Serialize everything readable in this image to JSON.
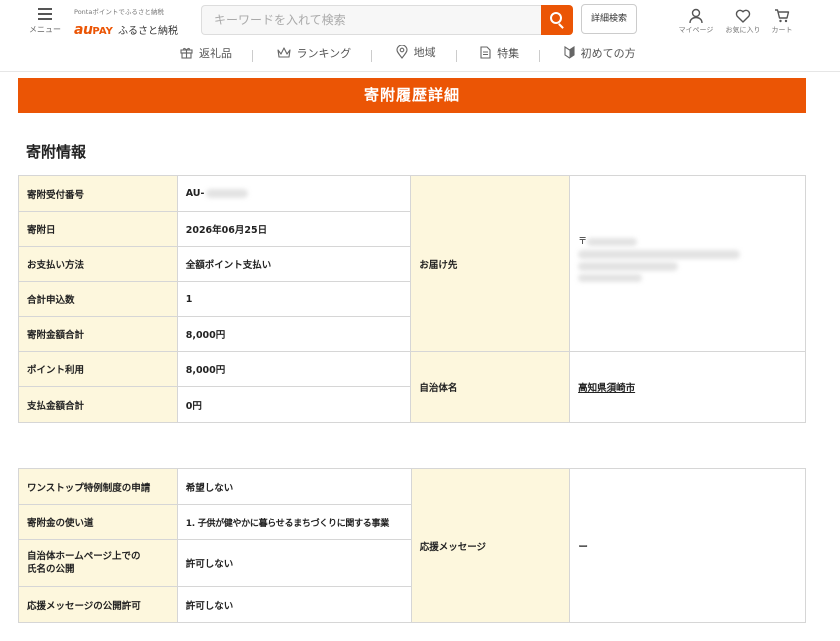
{
  "header": {
    "menu_label": "メニュー",
    "logo_tagline": "Pontaポイントでふるさと納税",
    "logo_au": "au",
    "logo_pay": "PAY",
    "logo_name": "ふるさと納税",
    "search_placeholder": "キーワードを入れて検索",
    "advanced_search": "詳細検索",
    "icons": [
      {
        "name": "mypage",
        "label": "マイページ"
      },
      {
        "name": "favorites",
        "label": "お気に入り"
      },
      {
        "name": "cart",
        "label": "カート"
      }
    ]
  },
  "nav": {
    "items": [
      "返礼品",
      "ランキング",
      "地域",
      "特集",
      "初めての方"
    ]
  },
  "page": {
    "banner": "寄附履歴詳細",
    "section_title": "寄附情報"
  },
  "table1": {
    "rows": [
      {
        "label": "寄附受付番号",
        "value": "AU-"
      },
      {
        "label": "寄附日",
        "value": "2026年06月25日"
      },
      {
        "label": "お支払い方法",
        "value": "全額ポイント支払い"
      },
      {
        "label": "合計申込数",
        "value": "1"
      },
      {
        "label": "寄附金額合計",
        "value": "8,000円"
      },
      {
        "label": "ポイント利用",
        "value": "8,000円"
      },
      {
        "label": "支払金額合計",
        "value": "0円"
      }
    ],
    "delivery_label": "お届け先",
    "delivery_prefix": "〒",
    "municipality_label": "自治体名",
    "municipality_value": "高知県須崎市"
  },
  "table2": {
    "rows": [
      {
        "label": "ワンストップ特例制度の申請",
        "value": "希望しない"
      },
      {
        "label": "寄附金の使い道",
        "value": "1. 子供が健やかに暮らせるまちづくりに関する事業"
      },
      {
        "label": "自治体ホームページ上での氏名の公開",
        "value": "許可しない"
      },
      {
        "label": "応援メッセージの公開許可",
        "value": "許可しない"
      }
    ],
    "message_label": "応援メッセージ",
    "message_value": "ー"
  },
  "colors": {
    "brand": "#eb5505",
    "label_bg": "#fdf7dd",
    "border": "#d6d6d6"
  }
}
